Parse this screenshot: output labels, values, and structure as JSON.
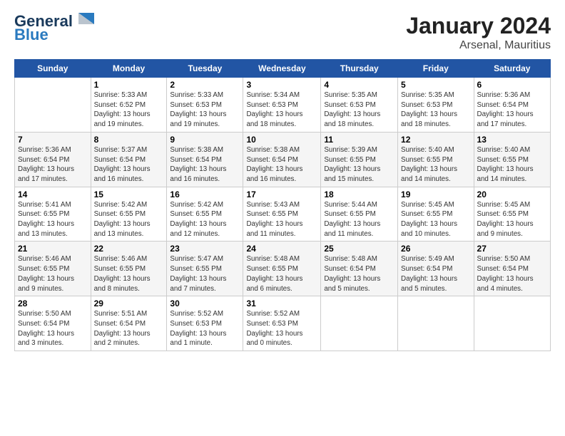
{
  "header": {
    "logo_line1": "General",
    "logo_line2": "Blue",
    "month": "January 2024",
    "location": "Arsenal, Mauritius"
  },
  "weekdays": [
    "Sunday",
    "Monday",
    "Tuesday",
    "Wednesday",
    "Thursday",
    "Friday",
    "Saturday"
  ],
  "weeks": [
    [
      {
        "day": "",
        "info": ""
      },
      {
        "day": "1",
        "info": "Sunrise: 5:33 AM\nSunset: 6:52 PM\nDaylight: 13 hours\nand 19 minutes."
      },
      {
        "day": "2",
        "info": "Sunrise: 5:33 AM\nSunset: 6:53 PM\nDaylight: 13 hours\nand 19 minutes."
      },
      {
        "day": "3",
        "info": "Sunrise: 5:34 AM\nSunset: 6:53 PM\nDaylight: 13 hours\nand 18 minutes."
      },
      {
        "day": "4",
        "info": "Sunrise: 5:35 AM\nSunset: 6:53 PM\nDaylight: 13 hours\nand 18 minutes."
      },
      {
        "day": "5",
        "info": "Sunrise: 5:35 AM\nSunset: 6:53 PM\nDaylight: 13 hours\nand 18 minutes."
      },
      {
        "day": "6",
        "info": "Sunrise: 5:36 AM\nSunset: 6:54 PM\nDaylight: 13 hours\nand 17 minutes."
      }
    ],
    [
      {
        "day": "7",
        "info": "Sunrise: 5:36 AM\nSunset: 6:54 PM\nDaylight: 13 hours\nand 17 minutes."
      },
      {
        "day": "8",
        "info": "Sunrise: 5:37 AM\nSunset: 6:54 PM\nDaylight: 13 hours\nand 16 minutes."
      },
      {
        "day": "9",
        "info": "Sunrise: 5:38 AM\nSunset: 6:54 PM\nDaylight: 13 hours\nand 16 minutes."
      },
      {
        "day": "10",
        "info": "Sunrise: 5:38 AM\nSunset: 6:54 PM\nDaylight: 13 hours\nand 16 minutes."
      },
      {
        "day": "11",
        "info": "Sunrise: 5:39 AM\nSunset: 6:55 PM\nDaylight: 13 hours\nand 15 minutes."
      },
      {
        "day": "12",
        "info": "Sunrise: 5:40 AM\nSunset: 6:55 PM\nDaylight: 13 hours\nand 14 minutes."
      },
      {
        "day": "13",
        "info": "Sunrise: 5:40 AM\nSunset: 6:55 PM\nDaylight: 13 hours\nand 14 minutes."
      }
    ],
    [
      {
        "day": "14",
        "info": "Sunrise: 5:41 AM\nSunset: 6:55 PM\nDaylight: 13 hours\nand 13 minutes."
      },
      {
        "day": "15",
        "info": "Sunrise: 5:42 AM\nSunset: 6:55 PM\nDaylight: 13 hours\nand 13 minutes."
      },
      {
        "day": "16",
        "info": "Sunrise: 5:42 AM\nSunset: 6:55 PM\nDaylight: 13 hours\nand 12 minutes."
      },
      {
        "day": "17",
        "info": "Sunrise: 5:43 AM\nSunset: 6:55 PM\nDaylight: 13 hours\nand 11 minutes."
      },
      {
        "day": "18",
        "info": "Sunrise: 5:44 AM\nSunset: 6:55 PM\nDaylight: 13 hours\nand 11 minutes."
      },
      {
        "day": "19",
        "info": "Sunrise: 5:45 AM\nSunset: 6:55 PM\nDaylight: 13 hours\nand 10 minutes."
      },
      {
        "day": "20",
        "info": "Sunrise: 5:45 AM\nSunset: 6:55 PM\nDaylight: 13 hours\nand 9 minutes."
      }
    ],
    [
      {
        "day": "21",
        "info": "Sunrise: 5:46 AM\nSunset: 6:55 PM\nDaylight: 13 hours\nand 9 minutes."
      },
      {
        "day": "22",
        "info": "Sunrise: 5:46 AM\nSunset: 6:55 PM\nDaylight: 13 hours\nand 8 minutes."
      },
      {
        "day": "23",
        "info": "Sunrise: 5:47 AM\nSunset: 6:55 PM\nDaylight: 13 hours\nand 7 minutes."
      },
      {
        "day": "24",
        "info": "Sunrise: 5:48 AM\nSunset: 6:55 PM\nDaylight: 13 hours\nand 6 minutes."
      },
      {
        "day": "25",
        "info": "Sunrise: 5:48 AM\nSunset: 6:54 PM\nDaylight: 13 hours\nand 5 minutes."
      },
      {
        "day": "26",
        "info": "Sunrise: 5:49 AM\nSunset: 6:54 PM\nDaylight: 13 hours\nand 5 minutes."
      },
      {
        "day": "27",
        "info": "Sunrise: 5:50 AM\nSunset: 6:54 PM\nDaylight: 13 hours\nand 4 minutes."
      }
    ],
    [
      {
        "day": "28",
        "info": "Sunrise: 5:50 AM\nSunset: 6:54 PM\nDaylight: 13 hours\nand 3 minutes."
      },
      {
        "day": "29",
        "info": "Sunrise: 5:51 AM\nSunset: 6:54 PM\nDaylight: 13 hours\nand 2 minutes."
      },
      {
        "day": "30",
        "info": "Sunrise: 5:52 AM\nSunset: 6:53 PM\nDaylight: 13 hours\nand 1 minute."
      },
      {
        "day": "31",
        "info": "Sunrise: 5:52 AM\nSunset: 6:53 PM\nDaylight: 13 hours\nand 0 minutes."
      },
      {
        "day": "",
        "info": ""
      },
      {
        "day": "",
        "info": ""
      },
      {
        "day": "",
        "info": ""
      }
    ]
  ]
}
